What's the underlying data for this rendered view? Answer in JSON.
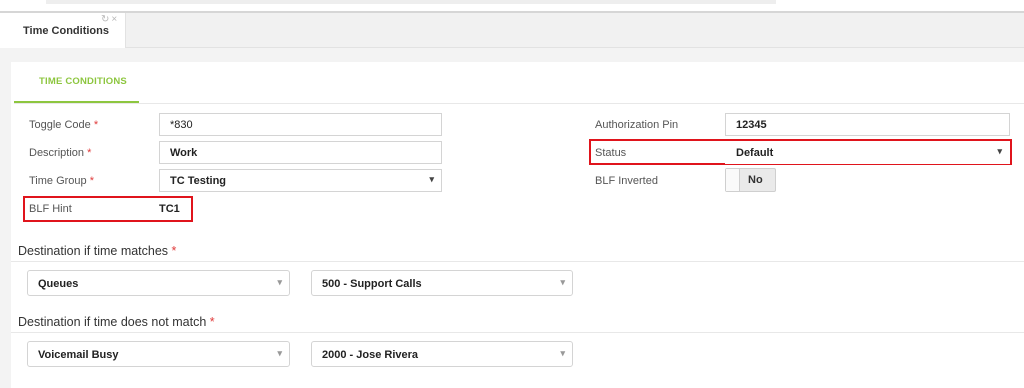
{
  "tab": {
    "label": "Time Conditions",
    "refresh_icon": "↻",
    "close_icon": "×"
  },
  "section": {
    "title": "TIME CONDITIONS"
  },
  "form": {
    "toggle_code": {
      "label": "Toggle Code",
      "required_mark": "*",
      "value": "*830"
    },
    "description": {
      "label": "Description",
      "required_mark": "*",
      "value": "Work"
    },
    "time_group": {
      "label": "Time Group",
      "required_mark": "*",
      "value": "TC Testing"
    },
    "blf_hint": {
      "label": "BLF Hint",
      "value": "TC1"
    },
    "authorization_pin": {
      "label": "Authorization Pin",
      "value": "12345"
    },
    "status": {
      "label": "Status",
      "value": "Default"
    },
    "blf_inverted": {
      "label": "BLF Inverted",
      "value": "No"
    }
  },
  "dest_match": {
    "title": "Destination if time matches",
    "required_mark": "*",
    "type": "Queues",
    "target": "500 - Support Calls"
  },
  "dest_nomatch": {
    "title": "Destination if time does not match",
    "required_mark": "*",
    "type": "Voicemail Busy",
    "target": "2000 - Jose Rivera"
  },
  "icons": {
    "caret_down": "▾",
    "caret_light": "▾"
  },
  "colors": {
    "accent_green": "#8dc63f",
    "highlight_red": "#e0141c",
    "required_red": "#e03a3a"
  }
}
